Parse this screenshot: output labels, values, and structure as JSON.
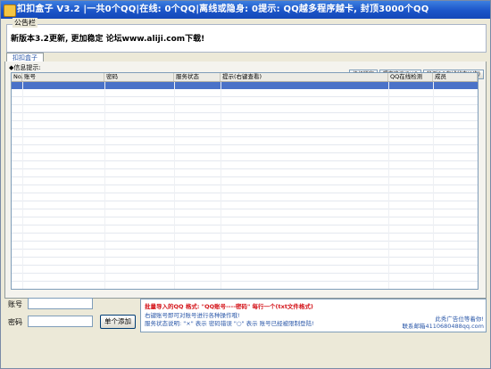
{
  "window": {
    "title": "扣扣盒子 V3.2 |一共0个QQ|在线: 0个QQ|离线或隐身: 0提示: QQ越多程序越卡, 封顶3000个QQ"
  },
  "notice": {
    "caption": "公告栏",
    "text": "新版本3.2更新, 更加稳定 论坛www.aliji.com下载!"
  },
  "tabs": [
    "扣扣盒子"
  ],
  "info_label": "◆信息提示:",
  "toolbar": {
    "buttons": [
      "挂机锁定",
      "提交建议/BUG",
      "检测QQ在线状态(1次)"
    ]
  },
  "table": {
    "columns": [
      "No.",
      "账号",
      "密码",
      "服务状态",
      "提示(右键查看)",
      "QQ在线检测",
      "成员"
    ]
  },
  "form": {
    "account_label": "账号",
    "password_label": "密码",
    "add_button": "单个添加"
  },
  "help": {
    "line1": "批量导入的QQ 格式: \"QQ账号----密码\" 每行一个(txt文件格式)",
    "line2": "右键账号即可对账号进行各种操作哦!",
    "line3": "服务状态说明: \"×\" 表示 密码错误 \"○\" 表示 账号已经被限制登陆!"
  },
  "ad": {
    "line1": "此秀广告位等着你!",
    "line2": "联系邮箱4110680488qq.com"
  }
}
